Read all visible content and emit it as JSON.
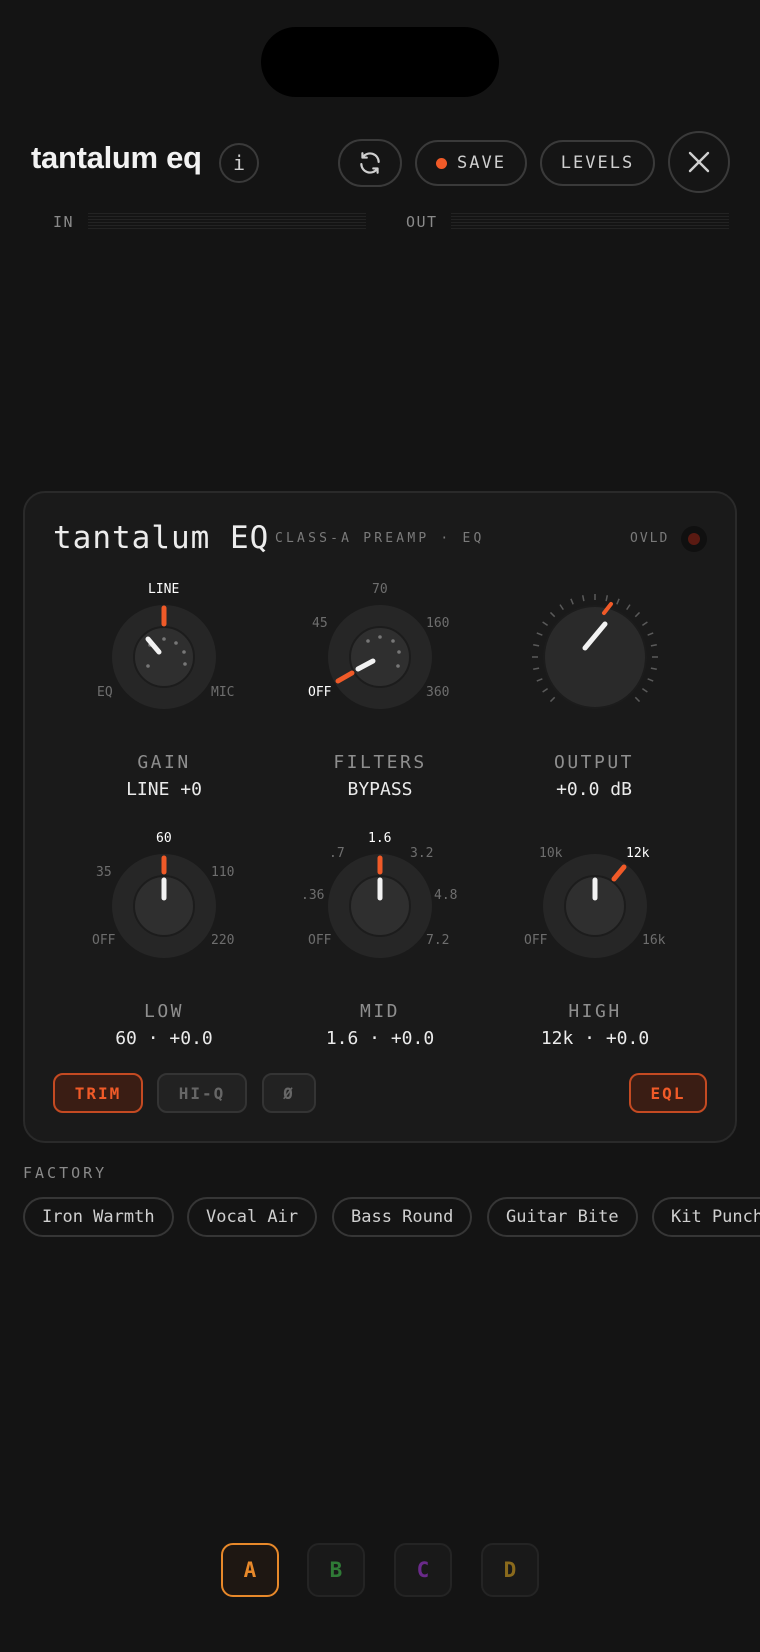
{
  "header": {
    "title": "tantalum eq",
    "info_label": "i",
    "save_label": "SAVE",
    "levels_label": "LEVELS"
  },
  "meters": {
    "in_label": "IN",
    "out_label": "OUT"
  },
  "panel": {
    "title": "tantalum EQ",
    "subtitle": "CLASS-A PREAMP · EQ",
    "ovld_label": "OVLD",
    "knobs": {
      "gain": {
        "name": "GAIN",
        "value": "LINE +0",
        "labels": [
          "LINE",
          "EQ",
          "MIC"
        ]
      },
      "filters": {
        "name": "FILTERS",
        "value": "BYPASS",
        "labels": [
          "70",
          "45",
          "160",
          "OFF",
          "360"
        ]
      },
      "output": {
        "name": "OUTPUT",
        "value": "+0.0 dB"
      },
      "low": {
        "name": "LOW",
        "value": "60 · +0.0",
        "labels": [
          "60",
          "35",
          "110",
          "OFF",
          "220"
        ]
      },
      "mid": {
        "name": "MID",
        "value": "1.6 · +0.0",
        "labels": [
          "1.6",
          ".7",
          "3.2",
          ".36",
          "4.8",
          "OFF",
          "7.2"
        ]
      },
      "high": {
        "name": "HIGH",
        "value": "12k · +0.0",
        "labels": [
          "10k",
          "12k",
          "OFF",
          "16k"
        ]
      }
    },
    "toggles": {
      "trim": "TRIM",
      "hiq": "HI-Q",
      "phase": "Ø",
      "eql": "EQL"
    }
  },
  "factory": {
    "label": "FACTORY",
    "presets": [
      "Iron Warmth",
      "Vocal Air",
      "Bass Round",
      "Guitar Bite",
      "Kit Punch"
    ]
  },
  "slots": [
    {
      "label": "A",
      "color": "#e8892a"
    },
    {
      "label": "B",
      "color": "#2f7a36"
    },
    {
      "label": "C",
      "color": "#6a2a8a"
    },
    {
      "label": "D",
      "color": "#8a6a1c"
    }
  ],
  "colors": {
    "accent": "#f05a28",
    "background": "#141414",
    "panel": "#1a1a1a"
  }
}
